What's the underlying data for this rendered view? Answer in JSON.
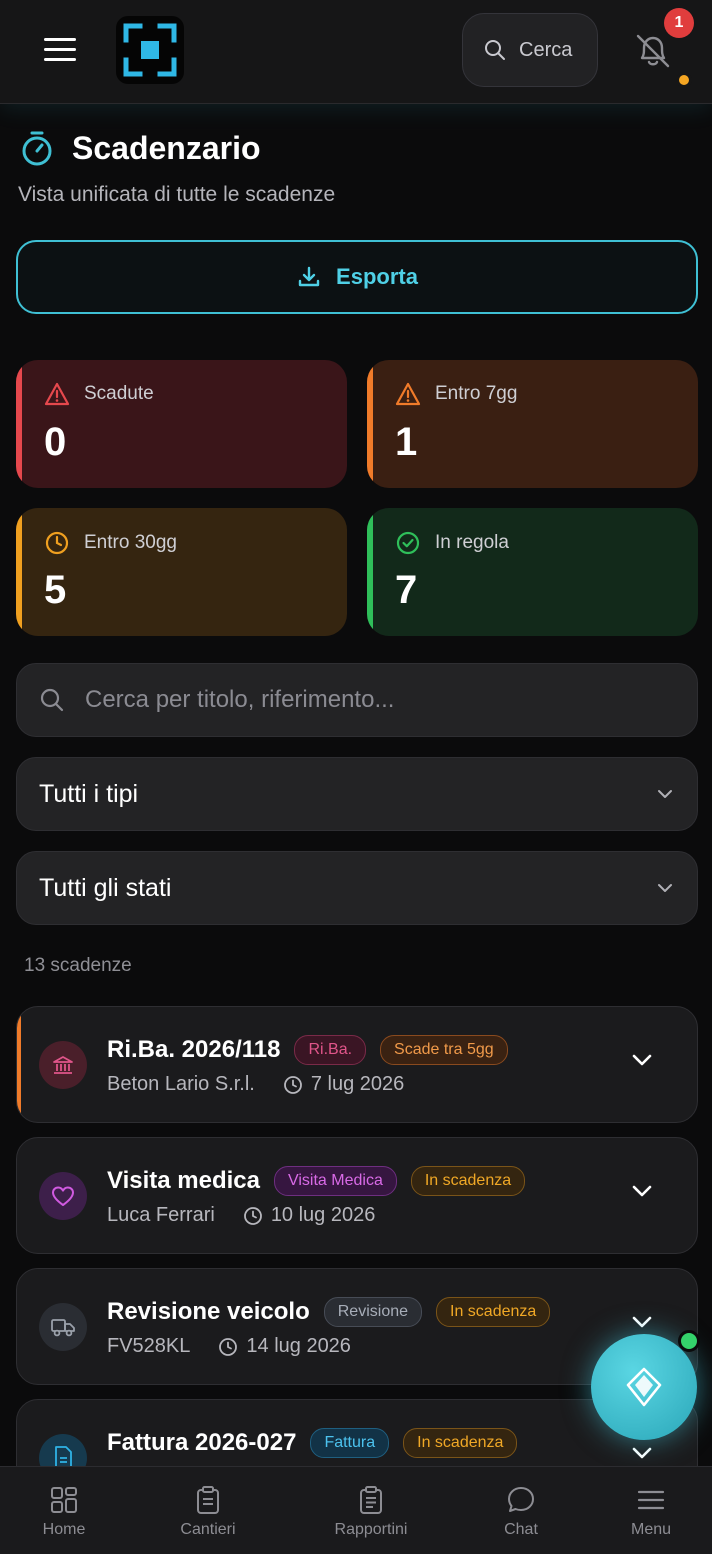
{
  "header": {
    "search_label": "Cerca",
    "notification_count": "1",
    "colors": {
      "accent": "#3fc0d4",
      "badge": "#e03d3d",
      "dot": "#f5a623"
    }
  },
  "page": {
    "title": "Scadenzario",
    "subtitle": "Vista unificata di tutte le scadenze",
    "export_label": "Esporta"
  },
  "stats": [
    {
      "label": "Scadute",
      "value": "0",
      "color": "#e5484d",
      "bg": "#3a1519"
    },
    {
      "label": "Entro 7gg",
      "value": "1",
      "color": "#f07b2a",
      "bg": "#3a1f12"
    },
    {
      "label": "Entro 30gg",
      "value": "5",
      "color": "#f0a020",
      "bg": "#352510"
    },
    {
      "label": "In regola",
      "value": "7",
      "color": "#2fbf5a",
      "bg": "#12291a"
    }
  ],
  "filters": {
    "search_placeholder": "Cerca per titolo, riferimento...",
    "type_select": "Tutti i tipi",
    "status_select": "Tutti gli stati"
  },
  "count_label": "13 scadenze",
  "deadlines": [
    {
      "title": "Ri.Ba. 2026/118",
      "type_badge": "Ri.Ba.",
      "status_badge": "Scade tra 5gg",
      "subject": "Beton Lario S.r.l.",
      "date": "7 lug 2026",
      "icon": "bank-icon"
    },
    {
      "title": "Visita medica",
      "type_badge": "Visita Medica",
      "status_badge": "In scadenza",
      "subject": "Luca Ferrari",
      "date": "10 lug 2026",
      "icon": "heart-icon"
    },
    {
      "title": "Revisione veicolo",
      "type_badge": "Revisione",
      "status_badge": "In scadenza",
      "subject": "FV528KL",
      "date": "14 lug 2026",
      "icon": "truck-icon"
    },
    {
      "title": "Fattura 2026-027",
      "type_badge": "Fattura",
      "status_badge": "In scadenza",
      "subject": "",
      "date": "",
      "icon": "invoice-icon"
    }
  ],
  "nav": [
    {
      "label": "Home",
      "icon": "home-icon"
    },
    {
      "label": "Cantieri",
      "icon": "clipboard-icon"
    },
    {
      "label": "Rapportini",
      "icon": "report-icon"
    },
    {
      "label": "Chat",
      "icon": "chat-icon"
    },
    {
      "label": "Menu",
      "icon": "menu-icon"
    }
  ]
}
